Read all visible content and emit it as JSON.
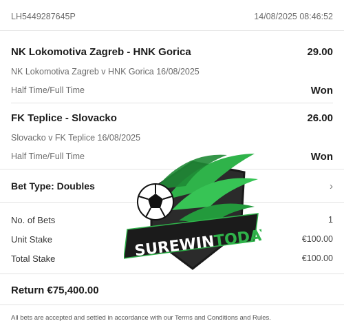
{
  "receipt": {
    "id": "LH5449287645P",
    "datetime": "14/08/2025 08:46:52"
  },
  "selections": [
    {
      "match": "NK Lokomotiva Zagreb - HNK Gorica",
      "odds": "29.00",
      "fixture": "NK Lokomotiva Zagreb v HNK Gorica 16/08/2025",
      "market": "Half Time/Full Time",
      "result": "Won"
    },
    {
      "match": "FK Teplice - Slovacko",
      "odds": "26.00",
      "fixture": "Slovacko v FK Teplice 16/08/2025",
      "market": "Half Time/Full Time",
      "result": "Won"
    }
  ],
  "bet_type": {
    "label": "Bet Type: Doubles",
    "chevron": "chevron-right-icon"
  },
  "summary": {
    "bets_label": "No. of Bets",
    "bets_value": "1",
    "unit_label": "Unit Stake",
    "unit_value": "€100.00",
    "total_label": "Total Stake",
    "total_value": "€100.00"
  },
  "return_text": "Return €75,400.00",
  "footer_text": "All bets are accepted and settled in accordance with our Terms and Conditions and Rules.",
  "watermark": {
    "text_white": "SUREWIN",
    "text_green": "TODAY"
  },
  "colors": {
    "logo_green": "#2fb34a",
    "logo_dark": "#2b2b2b"
  }
}
